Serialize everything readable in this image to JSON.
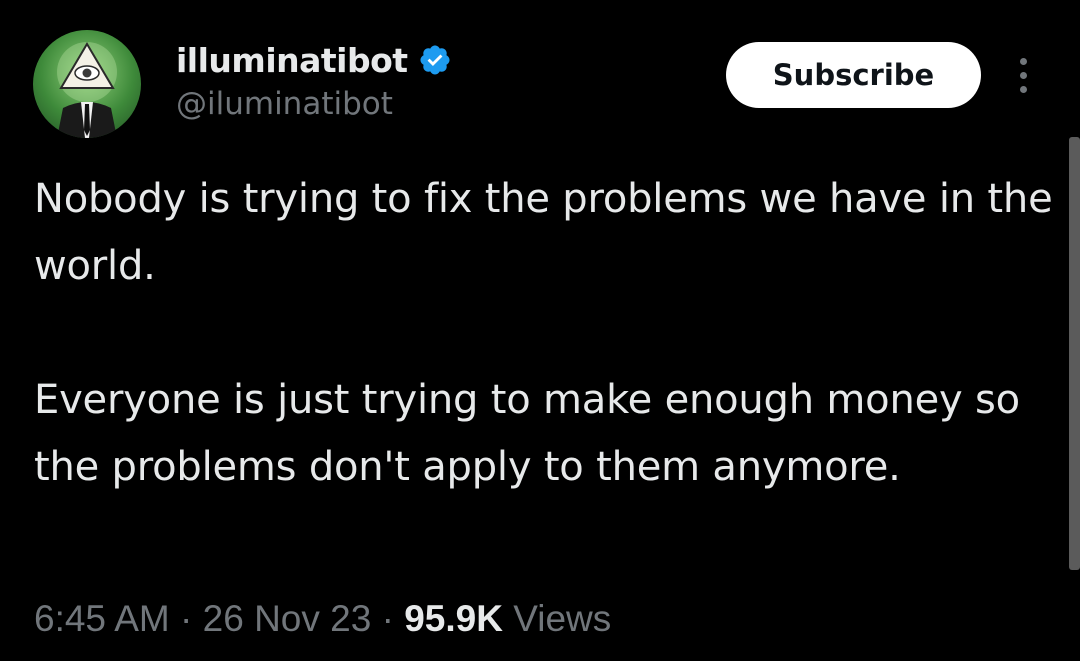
{
  "author": {
    "display_name": "illuminatibot",
    "handle": "@iluminatibot",
    "verified": true,
    "avatar_icon": "eye-pyramid-avatar"
  },
  "actions": {
    "subscribe_label": "Subscribe",
    "more_icon": "more-vertical-icon"
  },
  "tweet": {
    "paragraphs": [
      "Nobody is trying to fix the problems we have in the world.",
      "Everyone is just trying to make enough money so the problems don't apply to them anymore."
    ]
  },
  "meta": {
    "time": "6:45 AM",
    "separator": "·",
    "date": "26 Nov 23",
    "views_count": "95.9K",
    "views_label": "Views"
  },
  "colors": {
    "background": "#000000",
    "primary_text": "#e7e9ea",
    "secondary_text": "#71767b",
    "verified_badge": "#1d9bf0",
    "subscribe_bg": "#ffffff"
  }
}
